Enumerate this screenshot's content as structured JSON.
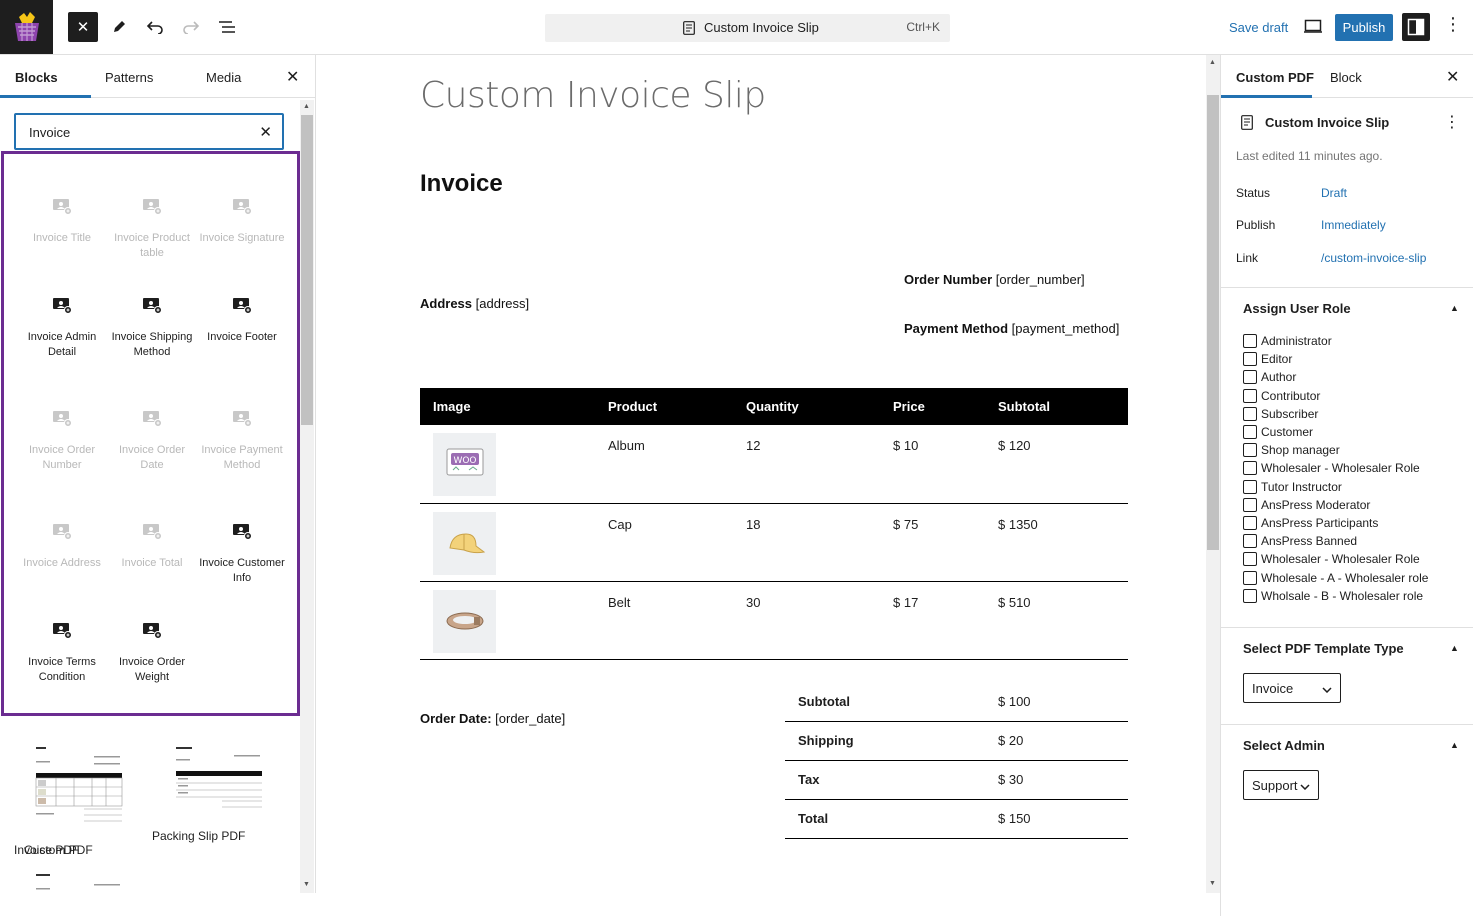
{
  "topbar": {
    "document_title": "Custom Invoice Slip",
    "shortcut": "Ctrl+K",
    "save_draft_label": "Save draft",
    "publish_label": "Publish"
  },
  "inserter": {
    "tabs": [
      "Blocks",
      "Patterns",
      "Media"
    ],
    "search_value": "Invoice",
    "blocks": [
      {
        "label": "Invoice Title",
        "disabled": true
      },
      {
        "label": "Invoice Product table",
        "disabled": true
      },
      {
        "label": "Invoice Signature",
        "disabled": true
      },
      {
        "label": "Invoice Admin Detail",
        "disabled": false
      },
      {
        "label": "Invoice Shipping Method",
        "disabled": false
      },
      {
        "label": "Invoice Footer",
        "disabled": false
      },
      {
        "label": "Invoice Order Number",
        "disabled": true
      },
      {
        "label": "Invoice Order Date",
        "disabled": true
      },
      {
        "label": "Invoice Payment Method",
        "disabled": true
      },
      {
        "label": "Invoice Address",
        "disabled": true
      },
      {
        "label": "Invoice Total",
        "disabled": true
      },
      {
        "label": "Invoice Customer Info",
        "disabled": false
      },
      {
        "label": "Invoice Terms Condition",
        "disabled": false
      },
      {
        "label": "Invoice Order Weight",
        "disabled": false
      }
    ],
    "patterns": [
      "Invoice PDF",
      "Packing Slip PDF",
      "Custom PDF"
    ]
  },
  "canvas": {
    "title": "Custom Invoice Slip",
    "heading": "Invoice",
    "order_number_label": "Order Number",
    "order_number_value": "[order_number]",
    "address_label": "Address",
    "address_value": "[address]",
    "payment_method_label": "Payment Method",
    "payment_method_value": "[payment_method]",
    "order_date_label": "Order Date:",
    "order_date_value": "[order_date]",
    "table": {
      "headers": [
        "Image",
        "Product",
        "Quantity",
        "Price",
        "Subtotal"
      ],
      "rows": [
        {
          "product": "Album",
          "quantity": "12",
          "price": "$ 10",
          "subtotal": "$ 120"
        },
        {
          "product": "Cap",
          "quantity": "18",
          "price": "$ 75",
          "subtotal": "$ 1350"
        },
        {
          "product": "Belt",
          "quantity": "30",
          "price": "$ 17",
          "subtotal": "$ 510"
        }
      ]
    },
    "totals": [
      {
        "label": "Subtotal",
        "value": "$ 100"
      },
      {
        "label": "Shipping",
        "value": "$ 20"
      },
      {
        "label": "Tax",
        "value": "$ 30"
      },
      {
        "label": "Total",
        "value": "$ 150"
      }
    ]
  },
  "settings": {
    "tabs": [
      "Custom PDF",
      "Block"
    ],
    "doc_title": "Custom Invoice Slip",
    "last_edited": "Last edited 11 minutes ago.",
    "status_label": "Status",
    "status_value": "Draft",
    "publish_label": "Publish",
    "publish_value": "Immediately",
    "link_label": "Link",
    "link_value": "/custom-invoice-slip",
    "assign_role_title": "Assign User Role",
    "roles": [
      "Administrator",
      "Editor",
      "Author",
      "Contributor",
      "Subscriber",
      "Customer",
      "Shop manager",
      "Wholesaler - Wholesaler Role",
      "Tutor Instructor",
      "AnsPress Moderator",
      "AnsPress Participants",
      "AnsPress Banned",
      "Wholesaler - Wholesaler Role",
      "Wholesale - A - Wholesaler role",
      "Wholsale - B - Wholesaler role"
    ],
    "template_type_title": "Select PDF Template Type",
    "template_type_value": "Invoice",
    "select_admin_title": "Select Admin",
    "select_admin_value": "Support"
  },
  "colors": {
    "accent": "#2271b1",
    "highlight_border": "#6b2c91",
    "logo_bg": "#1e1e1e"
  }
}
